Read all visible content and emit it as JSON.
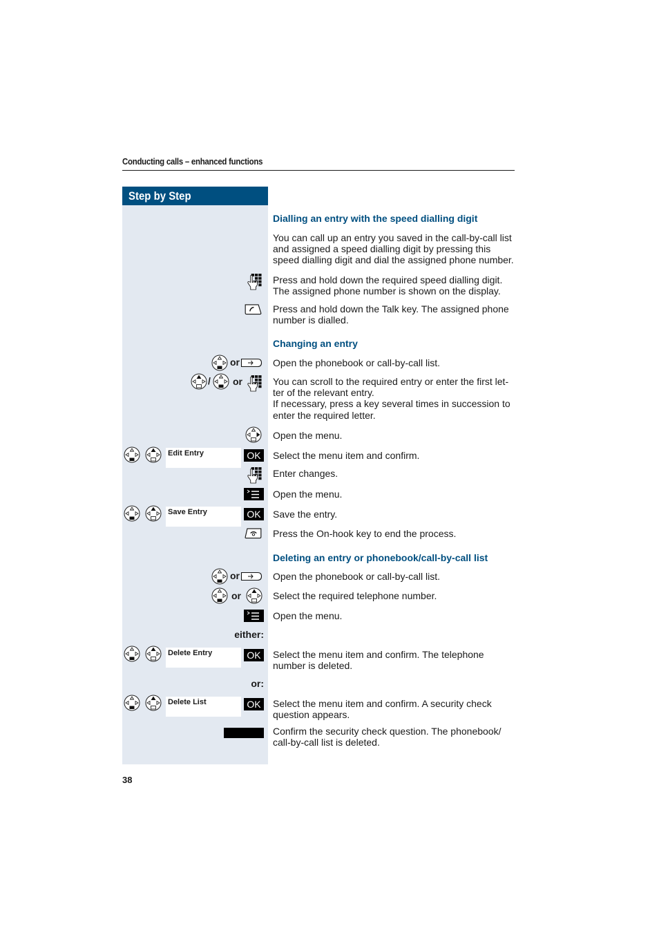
{
  "header": {
    "running_title": "Conducting calls – enhanced functions"
  },
  "sidebar": {
    "title": "Step by Step"
  },
  "colors": {
    "brand_blue": "#004f80",
    "sidebar_bg": "#e3e9f1"
  },
  "icons": {
    "nav_down": "control-key-down-icon",
    "nav_up": "control-key-up-icon",
    "nav_right": "control-key-right-icon",
    "keypad": "keypad-hand-icon",
    "talk": "talk-key-icon",
    "onhook": "on-hook-key-icon",
    "phonebook": "phonebook-key-icon",
    "menu": "menu-key-icon"
  },
  "sections": [
    {
      "title": "Dialling an entry with the speed dialling digit",
      "intro": "You can call up an entry you saved in the call-by-call list and assigned a speed dialling digit by pressing this speed dialling digit and dial the assigned phone number.",
      "steps": [
        "Press and hold down the required speed dialling digit. The assigned phone number is shown on the display.",
        "Press and hold down the Talk key. The assigned phone number is dialled."
      ]
    },
    {
      "title": "Changing an entry",
      "steps": [
        "Open the phonebook or call-by-call list.",
        "You can scroll to the required entry or enter the first let-ter of the relevant entry.\nIf necessary, press a key several times in succession to enter the required letter.",
        "Open the menu.",
        "Select the menu item and confirm.",
        "Enter changes.",
        "Open the menu.",
        "Save the entry.",
        "Press the On-hook key to end the process."
      ]
    },
    {
      "title": "Deleting an entry or phonebook/call-by-call list",
      "steps": [
        "Open the phonebook or call-by-call list.",
        "Select the required telephone number.",
        "Open the menu.",
        "Select the menu item and confirm. The telephone number is deleted.",
        "Select the menu item and confirm. A security check question appears.",
        "Confirm the security check question. The phonebook/ call-by-call list is deleted."
      ]
    }
  ],
  "labels": {
    "or": "or",
    "slash": "/",
    "either": "either:",
    "or_colon": "or:",
    "ok": "OK"
  },
  "displays": {
    "edit_entry": "Edit Entry",
    "save_entry": "Save Entry",
    "delete_entry": "Delete Entry",
    "delete_list": "Delete List"
  },
  "page_number": "38"
}
